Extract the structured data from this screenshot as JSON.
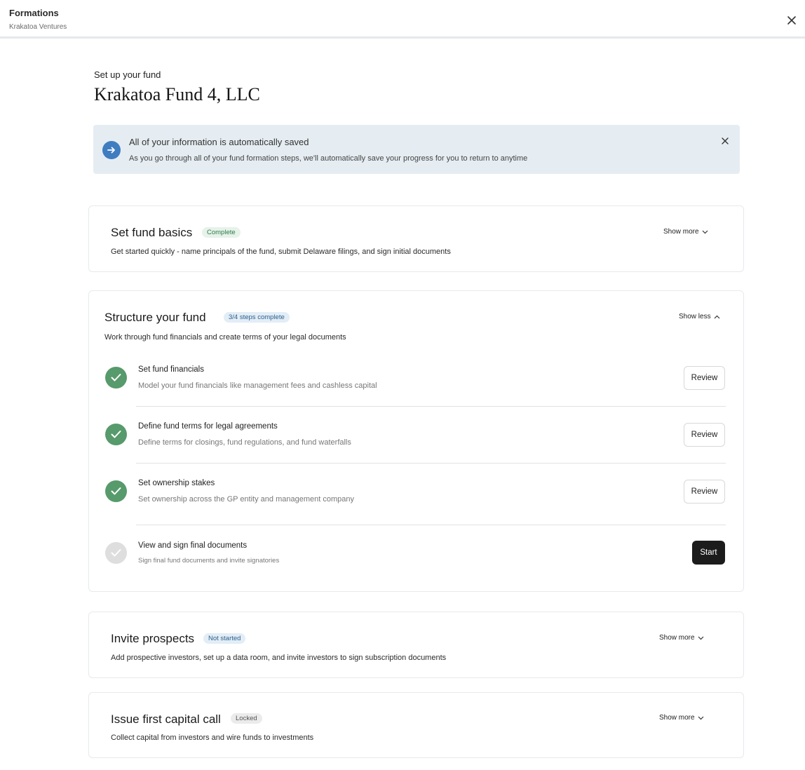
{
  "header": {
    "app_title": "Formations",
    "org_name": "Krakatoa Ventures",
    "close_icon": "close-icon"
  },
  "page": {
    "eyebrow": "Set up your fund",
    "fund_name": "Krakatoa Fund 4, LLC"
  },
  "banner": {
    "icon": "arrow-right-icon",
    "title": "All of your information is automatically saved",
    "body": "As you go through all of your fund formation steps, we'll automatically save your progress for you to return to anytime"
  },
  "sections": [
    {
      "title": "Set fund basics",
      "status": "Complete",
      "description": "Get started quickly - name principals of the fund, submit Delaware filings, and sign initial documents",
      "toggle": "Show more"
    },
    {
      "title": "Structure your fund",
      "status": "3/4 steps complete",
      "description": "Work through fund financials and create terms of your legal documents",
      "toggle": "Show less",
      "steps": [
        {
          "title": "Set fund financials",
          "description": "Model your fund financials like management fees and cashless capital",
          "action": "Review",
          "done": true
        },
        {
          "title": "Define fund terms for legal agreements",
          "description": "Define terms for closings, fund regulations, and fund waterfalls",
          "action": "Review",
          "done": true
        },
        {
          "title": "Set ownership stakes",
          "description": "Set ownership across the GP entity and management company",
          "action": "Review",
          "done": true
        },
        {
          "title": "View and sign final documents",
          "description": "Sign final fund documents and invite signatories",
          "action": "Start",
          "done": false
        }
      ]
    },
    {
      "title": "Invite prospects",
      "status": "Not started",
      "description": "Add prospective investors, set up a data room, and invite investors to sign subscription documents",
      "toggle": "Show more"
    },
    {
      "title": "Issue first capital call",
      "status": "Locked",
      "description": "Collect capital from investors and wire funds to investments",
      "toggle": "Show more"
    }
  ],
  "colors": {
    "accent_blue": "#3f7dc0",
    "success_green": "#579a6b",
    "banner_bg": "#e5edf2",
    "primary_button": "#1c1c1c"
  }
}
